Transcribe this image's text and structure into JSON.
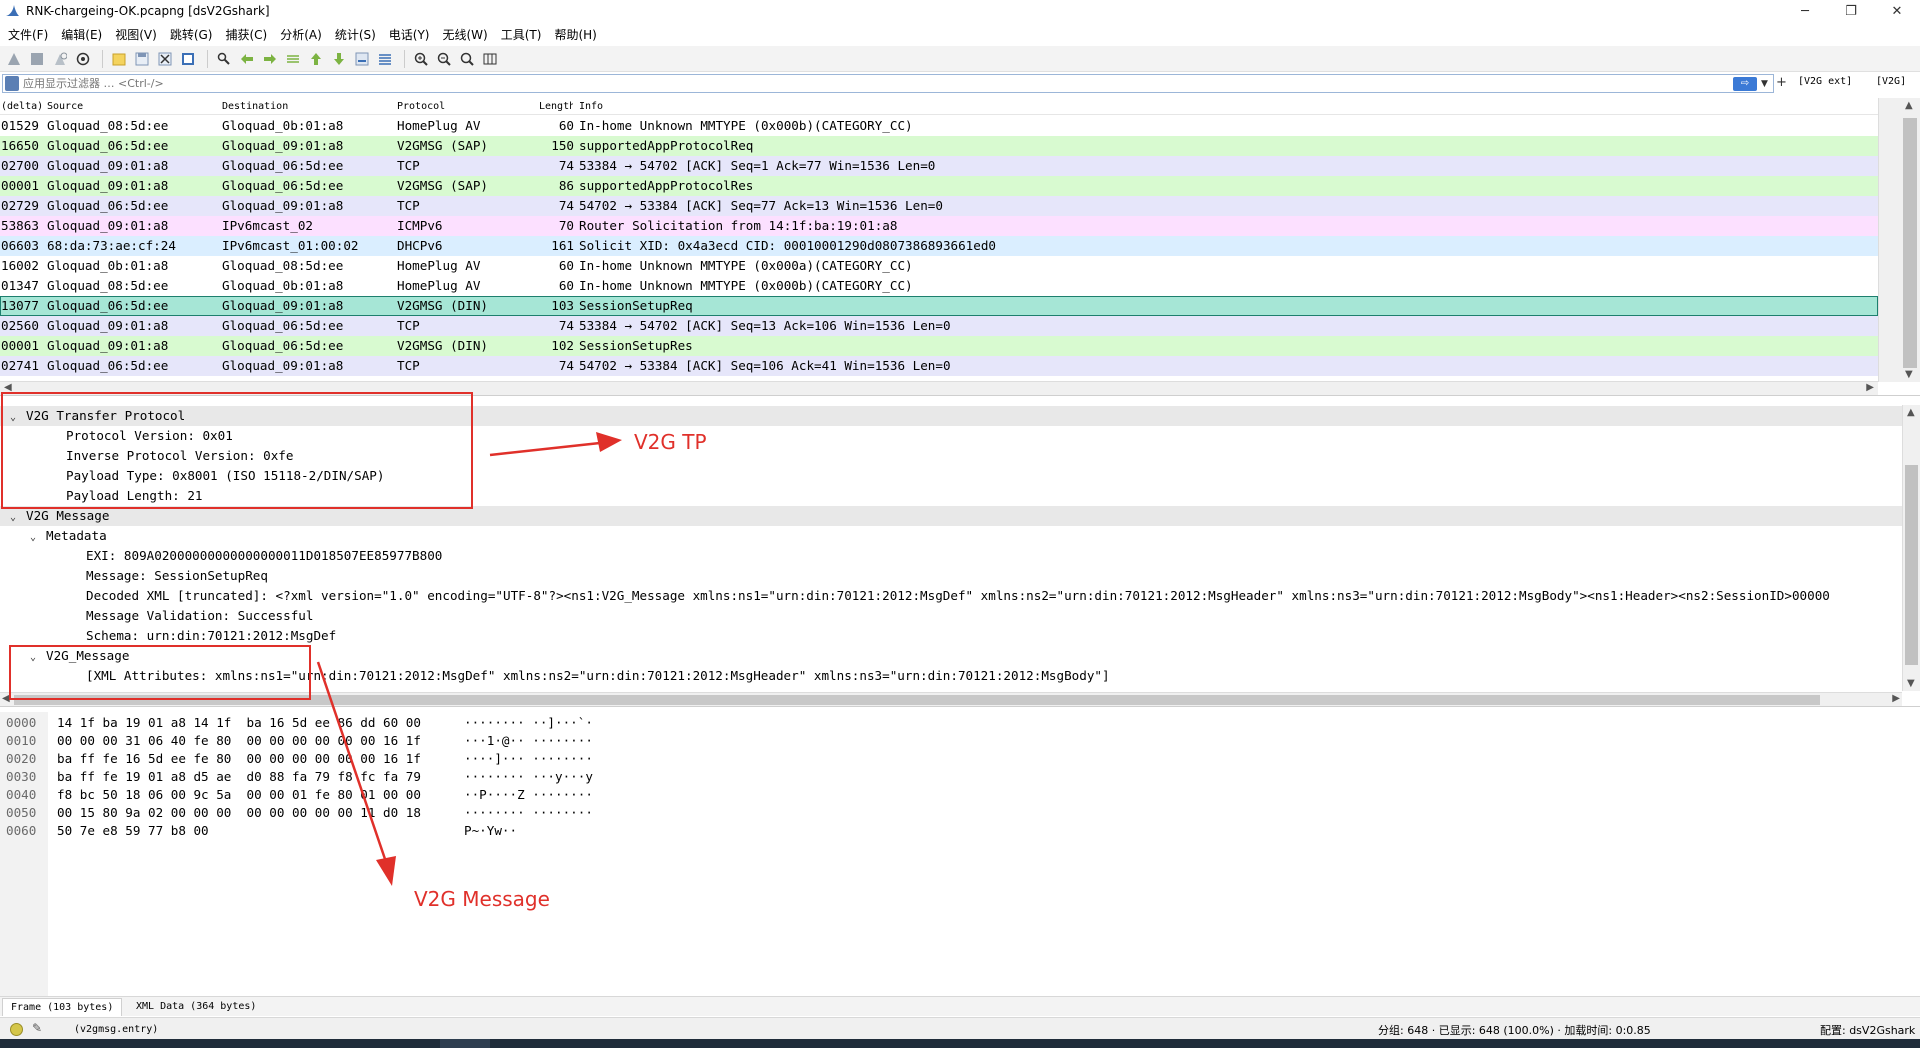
{
  "window": {
    "title": "RNK-chargeing-OK.pcapng [dsV2Gshark]",
    "minimize": "─",
    "maximize": "❐",
    "close": "✕"
  },
  "menu": [
    "文件(F)",
    "编辑(E)",
    "视图(V)",
    "跳转(G)",
    "捕获(C)",
    "分析(A)",
    "统计(S)",
    "电话(Y)",
    "无线(W)",
    "工具(T)",
    "帮助(H)"
  ],
  "filter": {
    "placeholder": "应用显示过滤器 … <Ctrl-/>",
    "apply_icon": "⇨",
    "plus_label": "+",
    "button1": "[V2G ext]",
    "button2": "[V2G]"
  },
  "packet_list": {
    "columns": [
      "(delta)",
      "Source",
      "Destination",
      "Protocol",
      "Length",
      "Info"
    ],
    "rows": [
      {
        "delta": "01529",
        "source": "Gloquad_08:5d:ee",
        "dest": "Gloquad_0b:01:a8",
        "proto": "HomePlug AV",
        "len": "60",
        "info": "In-home Unknown MMTYPE (0x000b)(CATEGORY_CC)",
        "bg": "#ffffff"
      },
      {
        "delta": "16650",
        "source": "Gloquad_06:5d:ee",
        "dest": "Gloquad_09:01:a8",
        "proto": "V2GMSG (SAP)",
        "len": "150",
        "info": "supportedAppProtocolReq",
        "bg": "#d8fad0"
      },
      {
        "delta": "02700",
        "source": "Gloquad_09:01:a8",
        "dest": "Gloquad_06:5d:ee",
        "proto": "TCP",
        "len": "74",
        "info": "53384 → 54702 [ACK] Seq=1 Ack=77 Win=1536 Len=0",
        "bg": "#e6e6fa"
      },
      {
        "delta": "00001",
        "source": "Gloquad_09:01:a8",
        "dest": "Gloquad_06:5d:ee",
        "proto": "V2GMSG (SAP)",
        "len": "86",
        "info": "supportedAppProtocolRes",
        "bg": "#d8fad0"
      },
      {
        "delta": "02729",
        "source": "Gloquad_06:5d:ee",
        "dest": "Gloquad_09:01:a8",
        "proto": "TCP",
        "len": "74",
        "info": "54702 → 53384 [ACK] Seq=77 Ack=13 Win=1536 Len=0",
        "bg": "#e6e6fa"
      },
      {
        "delta": "53863",
        "source": "Gloquad_09:01:a8",
        "dest": "IPv6mcast_02",
        "proto": "ICMPv6",
        "len": "70",
        "info": "Router Solicitation from 14:1f:ba:19:01:a8",
        "bg": "#fce0ff"
      },
      {
        "delta": "06603",
        "source": "68:da:73:ae:cf:24",
        "dest": "IPv6mcast_01:00:02",
        "proto": "DHCPv6",
        "len": "161",
        "info": "Solicit XID: 0x4a3ecd CID: 00010001290d0807386893661ed0",
        "bg": "#daeeff"
      },
      {
        "delta": "16002",
        "source": "Gloquad_0b:01:a8",
        "dest": "Gloquad_08:5d:ee",
        "proto": "HomePlug AV",
        "len": "60",
        "info": "In-home Unknown MMTYPE (0x000a)(CATEGORY_CC)",
        "bg": "#ffffff"
      },
      {
        "delta": "01347",
        "source": "Gloquad_08:5d:ee",
        "dest": "Gloquad_0b:01:a8",
        "proto": "HomePlug AV",
        "len": "60",
        "info": "In-home Unknown MMTYPE (0x000b)(CATEGORY_CC)",
        "bg": "#ffffff"
      },
      {
        "delta": "13077",
        "source": "Gloquad_06:5d:ee",
        "dest": "Gloquad_09:01:a8",
        "proto": "V2GMSG (DIN)",
        "len": "103",
        "info": "SessionSetupReq",
        "bg": "#a6e6d6",
        "selected": true
      },
      {
        "delta": "02560",
        "source": "Gloquad_09:01:a8",
        "dest": "Gloquad_06:5d:ee",
        "proto": "TCP",
        "len": "74",
        "info": "53384 → 54702 [ACK] Seq=13 Ack=106 Win=1536 Len=0",
        "bg": "#e6e6fa"
      },
      {
        "delta": "00001",
        "source": "Gloquad_09:01:a8",
        "dest": "Gloquad_06:5d:ee",
        "proto": "V2GMSG (DIN)",
        "len": "102",
        "info": "SessionSetupRes",
        "bg": "#d8fad0"
      },
      {
        "delta": "02741",
        "source": "Gloquad_06:5d:ee",
        "dest": "Gloquad_09:01:a8",
        "proto": "TCP",
        "len": "74",
        "info": "54702 → 53384 [ACK] Seq=106 Ack=41 Win=1536 Len=0",
        "bg": "#e6e6fa"
      }
    ]
  },
  "details": [
    {
      "text": "V2G Transfer Protocol",
      "indent": 0,
      "tw": "⌄",
      "hl": true
    },
    {
      "text": "Protocol Version: 0x01",
      "indent": 2,
      "tw": ""
    },
    {
      "text": "Inverse Protocol Version: 0xfe",
      "indent": 2,
      "tw": ""
    },
    {
      "text": "Payload Type: 0x8001 (ISO 15118-2/DIN/SAP)",
      "indent": 2,
      "tw": ""
    },
    {
      "text": "Payload Length: 21",
      "indent": 2,
      "tw": ""
    },
    {
      "text": "V2G Message",
      "indent": 0,
      "tw": "⌄",
      "hl": true
    },
    {
      "text": "Metadata",
      "indent": 1,
      "tw": "⌄"
    },
    {
      "text": "EXI: 809A02000000000000000011D018507EE85977B800",
      "indent": 3,
      "tw": ""
    },
    {
      "text": "Message: SessionSetupReq",
      "indent": 3,
      "tw": ""
    },
    {
      "text": "Decoded XML [truncated]: <?xml version=\"1.0\" encoding=\"UTF-8\"?><ns1:V2G_Message xmlns:ns1=\"urn:din:70121:2012:MsgDef\" xmlns:ns2=\"urn:din:70121:2012:MsgHeader\" xmlns:ns3=\"urn:din:70121:2012:MsgBody\"><ns1:Header><ns2:SessionID>00000",
      "indent": 3,
      "tw": ""
    },
    {
      "text": "Message Validation: Successful",
      "indent": 3,
      "tw": ""
    },
    {
      "text": "Schema: urn:din:70121:2012:MsgDef",
      "indent": 3,
      "tw": ""
    },
    {
      "text": "V2G_Message",
      "indent": 1,
      "tw": "⌄"
    },
    {
      "text": "[XML Attributes:  xmlns:ns1=\"urn:din:70121:2012:MsgDef\" xmlns:ns2=\"urn:din:70121:2012:MsgHeader\" xmlns:ns3=\"urn:din:70121:2012:MsgBody\"]",
      "indent": 3,
      "tw": ""
    }
  ],
  "bytes": [
    {
      "off": "0000",
      "hex": "14 1f ba 19 01 a8 14 1f  ba 16 5d ee 86 dd 60 00",
      "ascii": "········ ··]···`·"
    },
    {
      "off": "0010",
      "hex": "00 00 00 31 06 40 fe 80  00 00 00 00 00 00 16 1f",
      "ascii": "···1·@·· ········"
    },
    {
      "off": "0020",
      "hex": "ba ff fe 16 5d ee fe 80  00 00 00 00 00 00 16 1f",
      "ascii": "····]··· ········"
    },
    {
      "off": "0030",
      "hex": "ba ff fe 19 01 a8 d5 ae  d0 88 fa 79 f8 fc fa 79",
      "ascii": "········ ···y···y"
    },
    {
      "off": "0040",
      "hex": "f8 bc 50 18 06 00 9c 5a  00 00 01 fe 80 01 00 00",
      "ascii": "··P····Z ········"
    },
    {
      "off": "0050",
      "hex": "00 15 80 9a 02 00 00 00  00 00 00 00 00 11 d0 18",
      "ascii": "········ ········"
    },
    {
      "off": "0060",
      "hex": "50 7e e8 59 77 b8 00",
      "ascii": "P~·Yw··"
    }
  ],
  "byte_tabs": [
    "Frame (103 bytes)",
    "XML Data (364 bytes)"
  ],
  "status": {
    "field": "(v2gmsg.entry)",
    "packets": "分组: 648 · 已显示: 648 (100.0%) · 加载时间: 0:0.85",
    "profile": "配置: dsV2Gshark"
  },
  "annotations": {
    "tp_label": "V2G  TP",
    "msg_label": "V2G Message",
    "color": "#e0302a"
  },
  "icons": {
    "app": "shark-fin-icon"
  }
}
